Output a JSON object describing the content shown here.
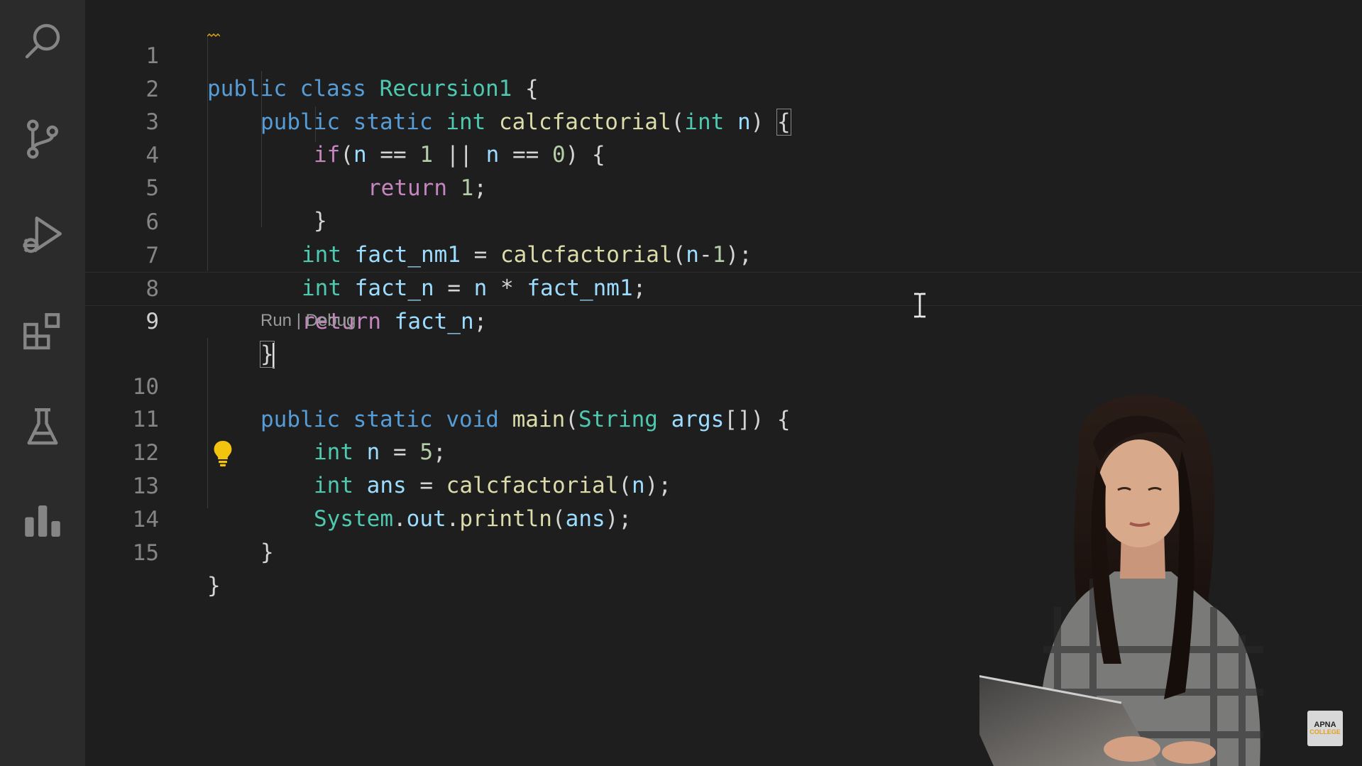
{
  "activity_bar": {
    "icons": [
      "search-icon",
      "source-control-icon",
      "run-debug-icon",
      "extensions-icon",
      "testing-icon",
      "charts-icon"
    ]
  },
  "editor": {
    "lines": [
      {
        "number": "1"
      },
      {
        "number": "2"
      },
      {
        "number": "3"
      },
      {
        "number": "4"
      },
      {
        "number": "5"
      },
      {
        "number": "6"
      },
      {
        "number": "7"
      },
      {
        "number": "8"
      },
      {
        "number": "9"
      },
      {
        "number": "10"
      },
      {
        "number": "11"
      },
      {
        "number": "12"
      },
      {
        "number": "13"
      },
      {
        "number": "14"
      },
      {
        "number": "15"
      }
    ],
    "code": {
      "l1": {
        "kw1": "public",
        "kw2": "class",
        "name": "Recursion1",
        "brace": " {"
      },
      "l2": {
        "kw1": "public",
        "kw2": "static",
        "type": "int",
        "fn": "calcfactorial",
        "open": "(",
        "ptype": "int",
        "param": "n",
        "close": ") ",
        "brace": "{"
      },
      "l3": {
        "kw": "if",
        "open": "(",
        "v1": "n",
        "op1": " == ",
        "n1": "1",
        "op2": " || ",
        "v2": "n",
        "op3": " == ",
        "n2": "0",
        "close": ") {"
      },
      "l4": {
        "kw": "return",
        "num": "1",
        "semi": ";"
      },
      "l5": {
        "brace": "}"
      },
      "l6": {
        "type": "int",
        "var": "fact_nm1",
        "eq": " = ",
        "fn": "calcfactorial",
        "open": "(",
        "arg": "n",
        "minus": "-",
        "num": "1",
        "close": ");"
      },
      "l7": {
        "type": "int",
        "var": "fact_n",
        "eq": " = ",
        "v1": "n",
        "op": " * ",
        "v2": "fact_nm1",
        "semi": ";"
      },
      "l8": {
        "kw": "return",
        "var": "fact_n",
        "semi": ";"
      },
      "l9": {
        "brace": "}"
      },
      "l10": {
        "kw1": "public",
        "kw2": "static",
        "kw3": "void",
        "fn": "main",
        "open": "(",
        "type": "String",
        "param": "args",
        "close": "[]) {"
      },
      "l11": {
        "type": "int",
        "var": "n",
        "eq": " = ",
        "num": "5",
        "semi": ";"
      },
      "l12": {
        "type": "int",
        "var": "ans",
        "eq": " = ",
        "fn": "calcfactorial",
        "open": "(",
        "arg": "n",
        "close": ");"
      },
      "l13": {
        "cls": "System",
        "dot1": ".",
        "field": "out",
        "dot2": ".",
        "fn": "println",
        "open": "(",
        "arg": "ans",
        "close": ");"
      },
      "l14": {
        "brace": "}"
      },
      "l15": {
        "brace": "}"
      }
    },
    "codelens": {
      "run": "Run",
      "sep": " | ",
      "debug": "Debug"
    },
    "current_line": "9"
  },
  "logo": {
    "line1": "APNA",
    "line2": "COLLEGE"
  },
  "colors": {
    "keyword": "#569cd6",
    "control": "#c586c0",
    "type": "#4ec9b0",
    "function": "#dcdcaa",
    "variable": "#9cdcfe",
    "number": "#b5cea8"
  }
}
